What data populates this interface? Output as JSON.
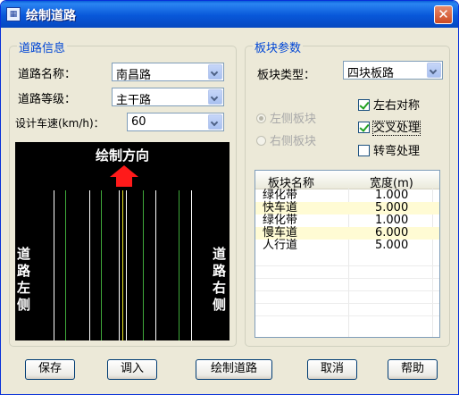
{
  "window": {
    "title": "绘制道路",
    "icon": "app-grid-icon",
    "close_glyph": "✕"
  },
  "road_info": {
    "legend": "道路信息",
    "name_label": "道路名称：",
    "name_value": "南昌路",
    "grade_label": "道路等级：",
    "grade_value": "主干路",
    "speed_label": "设计车速(km/h)：",
    "speed_value": "60",
    "preview": {
      "direction_label": "绘制方向",
      "left_label": "道路左侧",
      "right_label": "道路右侧",
      "arrow_color": "#ff1a1a",
      "line_colors": {
        "white": "#ffffff",
        "green": "#3fa83a",
        "yellow": "#e8e320"
      }
    }
  },
  "block_params": {
    "legend": "板块参数",
    "type_label": "板块类型：",
    "type_value": "四块板路",
    "left_side_radio": "左侧板块",
    "right_side_radio": "右侧板块",
    "symmetric_label": "左右对称",
    "symmetric_checked": true,
    "cross_label": "交叉处理",
    "cross_checked": true,
    "turn_label": "转弯处理",
    "turn_checked": false,
    "table": {
      "headers": [
        "板块名称",
        "宽度(m)"
      ],
      "rows": [
        [
          "绿化带",
          "1.000"
        ],
        [
          "快车道",
          "5.000"
        ],
        [
          "绿化带",
          "1.000"
        ],
        [
          "慢车道",
          "6.000"
        ],
        [
          "人行道",
          "5.000"
        ]
      ]
    }
  },
  "buttons": {
    "save": "保存",
    "load": "调入",
    "draw": "绘制道路",
    "cancel": "取消",
    "help": "帮助"
  },
  "colors": {
    "title_bar": "#0857d9",
    "dialog_bg": "#ece9d8",
    "legend_text": "#0046d5",
    "row_highlight": "#fffbd4"
  }
}
